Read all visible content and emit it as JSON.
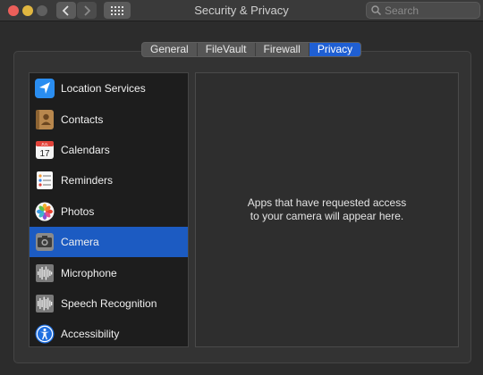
{
  "window": {
    "title": "Security & Privacy"
  },
  "search": {
    "placeholder": "Search"
  },
  "tabs": [
    {
      "label": "General",
      "active": false
    },
    {
      "label": "FileVault",
      "active": false
    },
    {
      "label": "Firewall",
      "active": false
    },
    {
      "label": "Privacy",
      "active": true
    }
  ],
  "sidebar": {
    "items": [
      {
        "label": "Location Services",
        "icon": "location-arrow-icon",
        "selected": false
      },
      {
        "label": "Contacts",
        "icon": "contacts-book-icon",
        "selected": false
      },
      {
        "label": "Calendars",
        "icon": "calendar-icon",
        "selected": false,
        "icon_text_month": "JUL",
        "icon_text_day": "17"
      },
      {
        "label": "Reminders",
        "icon": "reminders-list-icon",
        "selected": false
      },
      {
        "label": "Photos",
        "icon": "photos-flower-icon",
        "selected": false
      },
      {
        "label": "Camera",
        "icon": "camera-icon",
        "selected": true
      },
      {
        "label": "Microphone",
        "icon": "microphone-waveform-icon",
        "selected": false
      },
      {
        "label": "Speech Recognition",
        "icon": "speech-waveform-icon",
        "selected": false
      },
      {
        "label": "Accessibility",
        "icon": "accessibility-person-icon",
        "selected": false
      }
    ]
  },
  "panel": {
    "message_line1": "Apps that have requested access",
    "message_line2": "to your camera will appear here."
  },
  "colors": {
    "accent": "#1c5bc2",
    "window_bg": "#2c2c2c",
    "close": "#ec5f5a",
    "minimize": "#e0b640"
  }
}
